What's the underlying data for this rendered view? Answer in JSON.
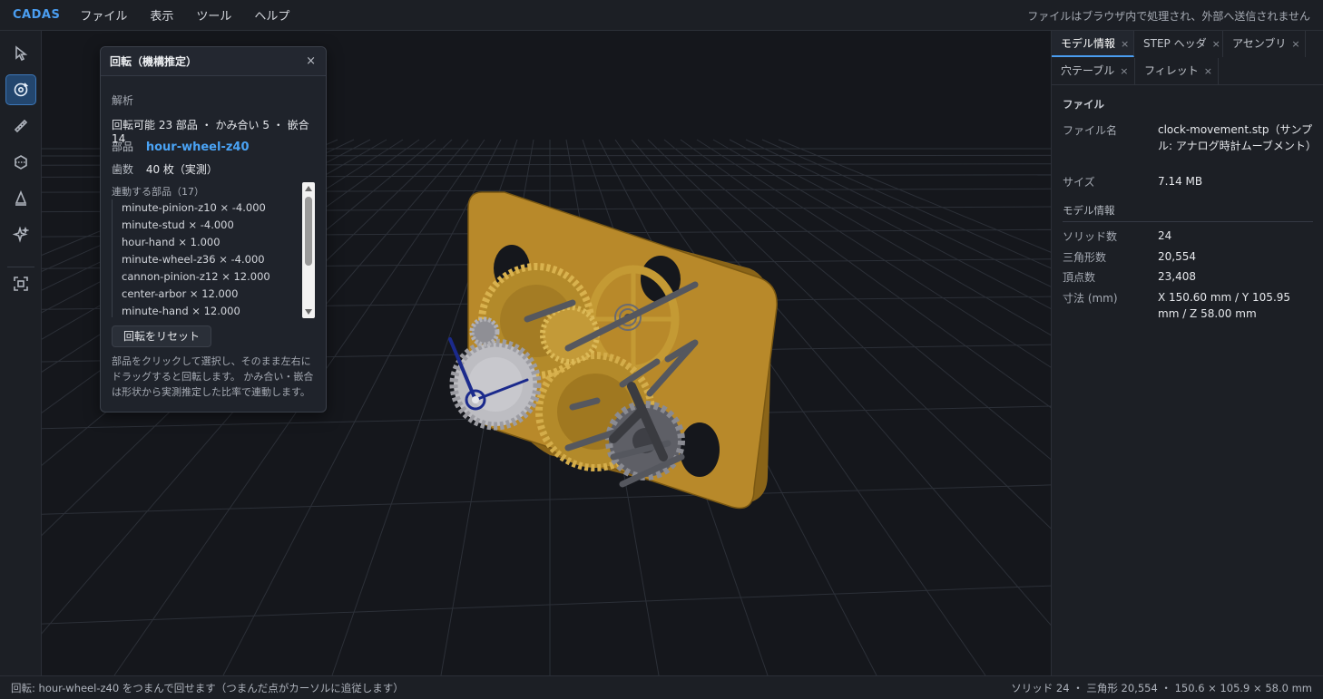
{
  "app": {
    "brand": "CADAS",
    "privacy_note": "ファイルはブラウザ内で処理され、外部へ送信されません"
  },
  "menu": [
    "ファイル",
    "表示",
    "ツール",
    "ヘルプ"
  ],
  "toolbar": {
    "tools": [
      {
        "icon": "pointer-icon",
        "active": false
      },
      {
        "icon": "rotate-gear-icon",
        "active": true
      },
      {
        "icon": "ruler-icon",
        "active": false
      },
      {
        "icon": "section-icon",
        "active": false
      },
      {
        "icon": "cone-icon",
        "active": false
      },
      {
        "icon": "sparkle-icon",
        "active": false
      },
      {
        "icon": "fit-view-icon",
        "active": false
      }
    ]
  },
  "panel": {
    "title": "回転（機構推定）",
    "close": "×",
    "section": "解析",
    "summary": "回転可能 23 部品 ・ かみ合い 5 ・ 嵌合 14",
    "part_label": "部品",
    "part_value": "hour-wheel-z40",
    "teeth_label": "歯数",
    "teeth_value": "40 枚（実測）",
    "linked_label": "連動する部品（17）",
    "linked_items": [
      "minute-pinion-z10 × -4.000",
      "minute-stud × -4.000",
      "hour-hand × 1.000",
      "minute-wheel-z36 × -4.000",
      "cannon-pinion-z12 × 12.000",
      "center-arbor × 12.000",
      "minute-hand × 12.000"
    ],
    "reset_label": "回転をリセット",
    "help": "部品をクリックして選択し、そのまま左右にドラッグすると回転します。 かみ合い・嵌合は形状から実測推定した比率で連動します。"
  },
  "sidebar": {
    "tabs": [
      {
        "label": "モデル情報",
        "active": true
      },
      {
        "label": "STEP ヘッダ",
        "active": false
      },
      {
        "label": "アセンブリ",
        "active": false
      },
      {
        "label": "穴テーブル",
        "active": false
      },
      {
        "label": "フィレット",
        "active": false
      }
    ],
    "tab_close": "×",
    "file_heading": "ファイル",
    "file_name_label": "ファイル名",
    "file_name_value": "clock-movement.stp（サンプル: アナログ時計ムーブメント）",
    "size_label": "サイズ",
    "size_value": "7.14 MB",
    "model_heading": "モデル情報",
    "solids_label": "ソリッド数",
    "solids_value": "24",
    "triangles_label": "三角形数",
    "triangles_value": "20,554",
    "vertices_label": "頂点数",
    "vertices_value": "23,408",
    "dims_label": "寸法 (mm)",
    "dims_value": "X 150.60 mm / Y 105.95 mm / Z 58.00 mm"
  },
  "status": {
    "left": "回転: hour-wheel-z40 をつまんで回せます（つまんだ点がカーソルに追従します）",
    "right": "ソリッド 24 ・ 三角形 20,554 ・ 150.6 × 105.9 × 58.0 mm"
  },
  "colors": {
    "accent": "#4a9df0",
    "plate": "#b8892a",
    "gear_gold": "#c9a23f",
    "gear_silver": "#a9a9ad",
    "hand": "#1b2a8c"
  }
}
